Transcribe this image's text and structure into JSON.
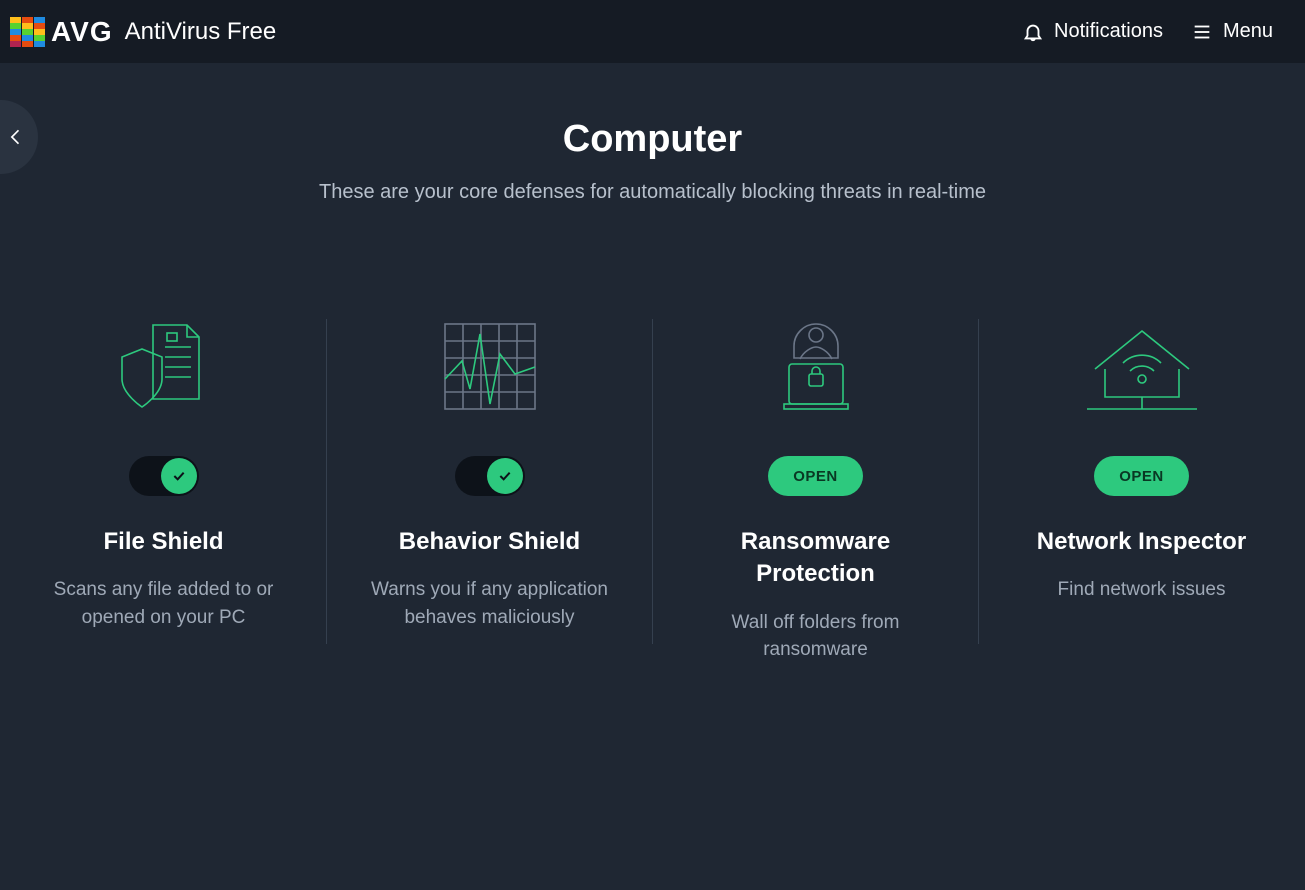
{
  "header": {
    "brand": "AVG",
    "product": "AntiVirus Free",
    "notifications_label": "Notifications",
    "menu_label": "Menu"
  },
  "page": {
    "title": "Computer",
    "subtitle": "These are your core defenses for automatically blocking threats in real-time"
  },
  "cards": [
    {
      "title": "File Shield",
      "description": "Scans any file added to or opened on your PC",
      "control": "toggle",
      "toggle_on": true
    },
    {
      "title": "Behavior Shield",
      "description": "Warns you if any application behaves maliciously",
      "control": "toggle",
      "toggle_on": true
    },
    {
      "title": "Ransomware Protection",
      "description": "Wall off folders from ransomware",
      "control": "button",
      "button_label": "OPEN"
    },
    {
      "title": "Network Inspector",
      "description": "Find network issues",
      "control": "button",
      "button_label": "OPEN"
    }
  ]
}
